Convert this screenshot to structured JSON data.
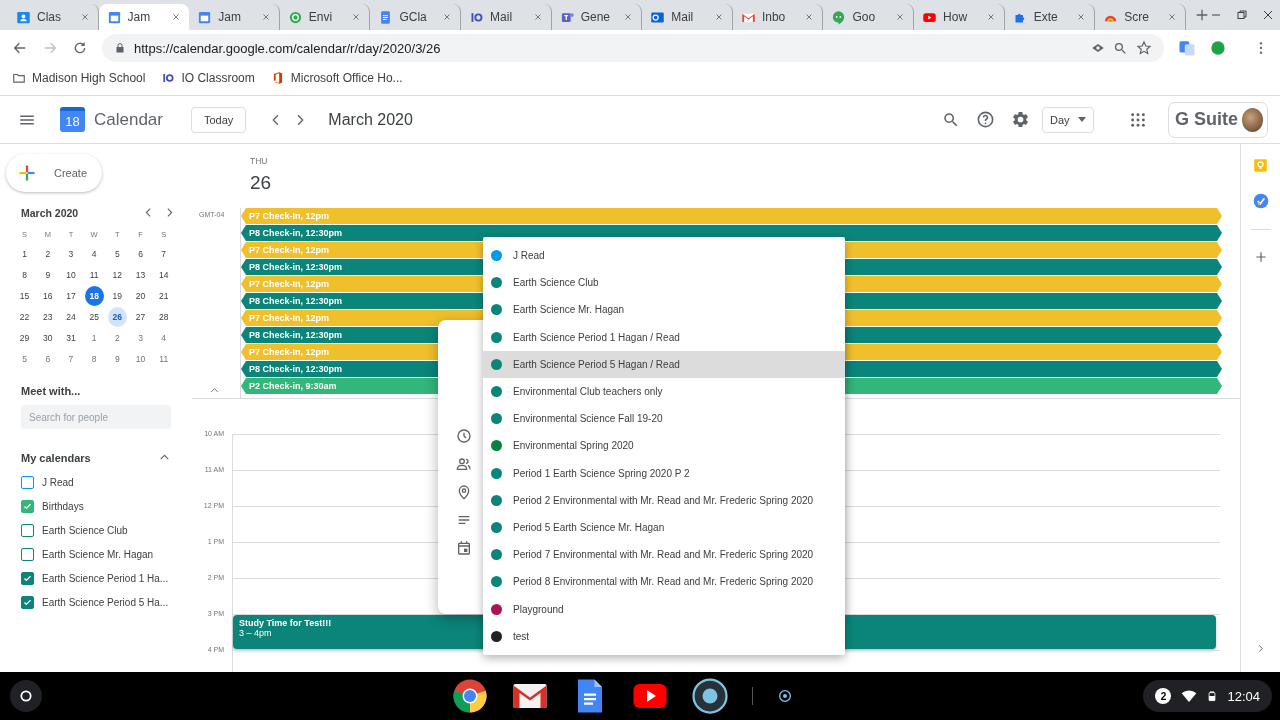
{
  "browser": {
    "tabs": [
      {
        "title": "Clas",
        "kind": "classroom",
        "selected": false
      },
      {
        "title": "Jam",
        "kind": "calendar",
        "selected": true
      },
      {
        "title": "Jam",
        "kind": "calendar",
        "selected": false
      },
      {
        "title": "Envi",
        "kind": "swirl",
        "selected": false
      },
      {
        "title": "GCla",
        "kind": "doc",
        "selected": false
      },
      {
        "title": "Mail",
        "kind": "io",
        "selected": false
      },
      {
        "title": "Gene",
        "kind": "teams",
        "selected": false
      },
      {
        "title": "Mail",
        "kind": "outlook",
        "selected": false
      },
      {
        "title": "Inbo",
        "kind": "gmail",
        "selected": false
      },
      {
        "title": "Goo",
        "kind": "chat",
        "selected": false
      },
      {
        "title": "How",
        "kind": "video",
        "selected": false
      },
      {
        "title": "Exte",
        "kind": "puzzle",
        "selected": false
      },
      {
        "title": "Scre",
        "kind": "screencast",
        "selected": false
      }
    ],
    "url": "https://calendar.google.com/calendar/r/day/2020/3/26",
    "bookmarks": [
      {
        "label": "Madison High School",
        "kind": "folder"
      },
      {
        "label": "IO Classroom",
        "kind": "io"
      },
      {
        "label": "Microsoft Office Ho...",
        "kind": "office"
      }
    ]
  },
  "app": {
    "title": "Calendar",
    "logo_day": "18",
    "today_button": "Today",
    "period": "March 2020",
    "view_select": "Day",
    "brand": "G Suite"
  },
  "sidebar": {
    "create_button": "Create",
    "mini_calendar": {
      "title": "March 2020",
      "weekdays": [
        "S",
        "M",
        "T",
        "W",
        "T",
        "F",
        "S"
      ],
      "weeks": [
        [
          {
            "day": "1",
            "muted": false,
            "today": false,
            "selected": false
          },
          {
            "day": "2",
            "muted": false,
            "today": false,
            "selected": false
          },
          {
            "day": "3",
            "muted": false,
            "today": false,
            "selected": false
          },
          {
            "day": "4",
            "muted": false,
            "today": false,
            "selected": false
          },
          {
            "day": "5",
            "muted": false,
            "today": false,
            "selected": false
          },
          {
            "day": "6",
            "muted": false,
            "today": false,
            "selected": false
          },
          {
            "day": "7",
            "muted": false,
            "today": false,
            "selected": false
          }
        ],
        [
          {
            "day": "8",
            "muted": false,
            "today": false,
            "selected": false
          },
          {
            "day": "9",
            "muted": false,
            "today": false,
            "selected": false
          },
          {
            "day": "10",
            "muted": false,
            "today": false,
            "selected": false
          },
          {
            "day": "11",
            "muted": false,
            "today": false,
            "selected": false
          },
          {
            "day": "12",
            "muted": false,
            "today": false,
            "selected": false
          },
          {
            "day": "13",
            "muted": false,
            "today": false,
            "selected": false
          },
          {
            "day": "14",
            "muted": false,
            "today": false,
            "selected": false
          }
        ],
        [
          {
            "day": "15",
            "muted": false,
            "today": false,
            "selected": false
          },
          {
            "day": "16",
            "muted": false,
            "today": false,
            "selected": false
          },
          {
            "day": "17",
            "muted": false,
            "today": false,
            "selected": false
          },
          {
            "day": "18",
            "muted": false,
            "today": true,
            "selected": false
          },
          {
            "day": "19",
            "muted": false,
            "today": false,
            "selected": false
          },
          {
            "day": "20",
            "muted": false,
            "today": false,
            "selected": false
          },
          {
            "day": "21",
            "muted": false,
            "today": false,
            "selected": false
          }
        ],
        [
          {
            "day": "22",
            "muted": false,
            "today": false,
            "selected": false
          },
          {
            "day": "23",
            "muted": false,
            "today": false,
            "selected": false
          },
          {
            "day": "24",
            "muted": false,
            "today": false,
            "selected": false
          },
          {
            "day": "25",
            "muted": false,
            "today": false,
            "selected": false
          },
          {
            "day": "26",
            "muted": false,
            "today": false,
            "selected": true
          },
          {
            "day": "27",
            "muted": false,
            "today": false,
            "selected": false
          },
          {
            "day": "28",
            "muted": false,
            "today": false,
            "selected": false
          }
        ],
        [
          {
            "day": "29",
            "muted": false,
            "today": false,
            "selected": false
          },
          {
            "day": "30",
            "muted": false,
            "today": false,
            "selected": false
          },
          {
            "day": "31",
            "muted": false,
            "today": false,
            "selected": false
          },
          {
            "day": "1",
            "muted": true,
            "today": false,
            "selected": false
          },
          {
            "day": "2",
            "muted": true,
            "today": false,
            "selected": false
          },
          {
            "day": "3",
            "muted": true,
            "today": false,
            "selected": false
          },
          {
            "day": "4",
            "muted": true,
            "today": false,
            "selected": false
          }
        ],
        [
          {
            "day": "5",
            "muted": true,
            "today": false,
            "selected": false
          },
          {
            "day": "6",
            "muted": true,
            "today": false,
            "selected": false
          },
          {
            "day": "7",
            "muted": true,
            "today": false,
            "selected": false
          },
          {
            "day": "8",
            "muted": true,
            "today": false,
            "selected": false
          },
          {
            "day": "9",
            "muted": true,
            "today": false,
            "selected": false
          },
          {
            "day": "10",
            "muted": true,
            "today": false,
            "selected": false
          },
          {
            "day": "11",
            "muted": true,
            "today": false,
            "selected": false
          }
        ]
      ]
    },
    "meet_with": {
      "title": "Meet with...",
      "placeholder": "Search for people"
    },
    "my_calendars": {
      "title": "My calendars",
      "expanded": true,
      "items": [
        {
          "label": "J Read",
          "checked": false,
          "color": "#039be5"
        },
        {
          "label": "Birthdays",
          "checked": true,
          "color": "#33b679"
        },
        {
          "label": "Earth Science Club",
          "checked": false,
          "color": "#0b8579"
        },
        {
          "label": "Earth Science Mr. Hagan",
          "checked": false,
          "color": "#0b8579"
        },
        {
          "label": "Earth Science Period 1 Ha...",
          "checked": true,
          "color": "#0b8579"
        },
        {
          "label": "Earth Science Period 5 Ha...",
          "checked": true,
          "color": "#0b8579"
        }
      ]
    }
  },
  "day_view": {
    "weekday": "THU",
    "date": "26",
    "timezone": "GMT-04",
    "stacked_events": [
      {
        "title": "P7 Check-In, 12pm",
        "color": "#f0c02c"
      },
      {
        "title": "P8 Check-in, 12:30pm",
        "color": "#0b8579"
      },
      {
        "title": "P7 Check-In, 12pm",
        "color": "#f0c02c"
      },
      {
        "title": "P8 Check-in, 12:30pm",
        "color": "#0b8579"
      },
      {
        "title": "P7 Check-In, 12pm",
        "color": "#f0c02c"
      },
      {
        "title": "P8 Check-in, 12:30pm",
        "color": "#0b8579"
      },
      {
        "title": "P7 Check-In, 12pm",
        "color": "#f0c02c"
      },
      {
        "title": "P8 Check-in, 12:30pm",
        "color": "#0b8579"
      },
      {
        "title": "P7 Check-In, 12pm",
        "color": "#f0c02c"
      },
      {
        "title": "P8 Check-in, 12:30pm",
        "color": "#0b8579"
      },
      {
        "title": "P2 Check-in, 9:30am",
        "color": "#33b679"
      }
    ],
    "hours": [
      {
        "label": "10 AM"
      },
      {
        "label": "11 AM"
      },
      {
        "label": "12 PM"
      },
      {
        "label": "1 PM"
      },
      {
        "label": "2 PM"
      },
      {
        "label": "3 PM",
        "events": [
          {
            "title": "Study Time for Test!!!",
            "time": "3 – 4pm",
            "color": "#0b8579"
          }
        ]
      },
      {
        "label": "4 PM"
      }
    ]
  },
  "calendar_menu": {
    "options": [
      {
        "label": "J Read",
        "color": "#039be5",
        "selected": false
      },
      {
        "label": "Earth Science Club",
        "color": "#0b8579",
        "selected": false
      },
      {
        "label": "Earth Science Mr. Hagan",
        "color": "#0b8579",
        "selected": false
      },
      {
        "label": "Earth Science Period 1 Hagan / Read",
        "color": "#0b8579",
        "selected": false
      },
      {
        "label": "Earth Science Period 5 Hagan / Read",
        "color": "#0b8579",
        "selected": true
      },
      {
        "label": "Environmental Club teachers only",
        "color": "#0b8579",
        "selected": false
      },
      {
        "label": "Environmental Science Fall 19-20",
        "color": "#0b8579",
        "selected": false
      },
      {
        "label": "Environmental Spring 2020",
        "color": "#0b8043",
        "selected": false
      },
      {
        "label": "Period 1 Earth Science Spring 2020 P 2",
        "color": "#0b8579",
        "selected": false
      },
      {
        "label": "Period 2 Environmental with Mr. Read and Mr. Frederic Spring 2020",
        "color": "#0b8579",
        "selected": false
      },
      {
        "label": "Period 5 Earth Science Mr. Hagan",
        "color": "#0b8579",
        "selected": false
      },
      {
        "label": "Period 7 Environmental with Mr. Read and Mr. Frederic Spring 2020",
        "color": "#0b8579",
        "selected": false
      },
      {
        "label": "Period 8 Environmental with Mr. Read and Mr. Frederic Spring 2020",
        "color": "#0b8579",
        "selected": false
      },
      {
        "label": "Playground",
        "color": "#ad1457",
        "selected": false
      },
      {
        "label": "test",
        "color": "#202124",
        "selected": false
      }
    ]
  },
  "shelf": {
    "apps": [
      {
        "kind": "chrome"
      },
      {
        "kind": "gmail"
      },
      {
        "kind": "docs"
      },
      {
        "kind": "youtube"
      },
      {
        "kind": "recorder"
      },
      {
        "kind": "dot"
      }
    ],
    "notifications": "2",
    "time": "12:04"
  }
}
